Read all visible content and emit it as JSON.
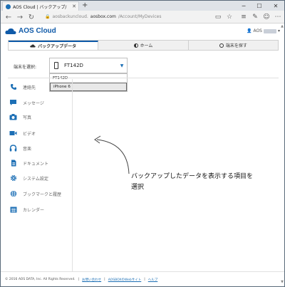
{
  "browser": {
    "tab_title": "AOS Cloud | バックアップ/",
    "new_tab": "+",
    "url_prefix": "aosbackuncloud.",
    "url_host": "aosbox.com",
    "url_path": "/Account/MyDevices",
    "minimize": "─",
    "maximize": "☐",
    "close": "✕"
  },
  "header": {
    "logo_text": "AOS Cloud",
    "user_label": "AOS",
    "user_caret": "▾"
  },
  "nav": {
    "tabs": [
      {
        "label": "バックアップデータ",
        "icon": "cloud-icon"
      },
      {
        "label": "ホーム",
        "icon": "home-icon"
      },
      {
        "label": "端末を探す",
        "icon": "compass-icon"
      }
    ]
  },
  "device_select": {
    "label": "端末を選択:",
    "value": "FT142D",
    "options": [
      "FT142D",
      "iPhone 6"
    ]
  },
  "sidebar": {
    "items": [
      {
        "label": "連絡先",
        "icon": "phone-icon"
      },
      {
        "label": "メッセージ",
        "icon": "message-icon"
      },
      {
        "label": "写真",
        "icon": "camera-icon"
      },
      {
        "label": "ビデオ",
        "icon": "video-icon"
      },
      {
        "label": "音楽",
        "icon": "headphones-icon"
      },
      {
        "label": "ドキュメント",
        "icon": "document-icon"
      },
      {
        "label": "システム設定",
        "icon": "gear-icon"
      },
      {
        "label": "ブックマークと履歴",
        "icon": "globe-icon"
      },
      {
        "label": "カレンダー",
        "icon": "calendar-icon"
      }
    ]
  },
  "annotation": {
    "line1": "バックアップしたデータを表示する項目を",
    "line2": "選択"
  },
  "footer": {
    "copyright": "© 2016 AOS DATA, Inc. All Rights Reserved.",
    "links": [
      "お問い合わせ",
      "AOSBOXのWebサイト",
      "ヘルプ"
    ],
    "sep": "|"
  },
  "colors": {
    "brand": "#0f5aa8",
    "accent": "#1c6fb5"
  }
}
